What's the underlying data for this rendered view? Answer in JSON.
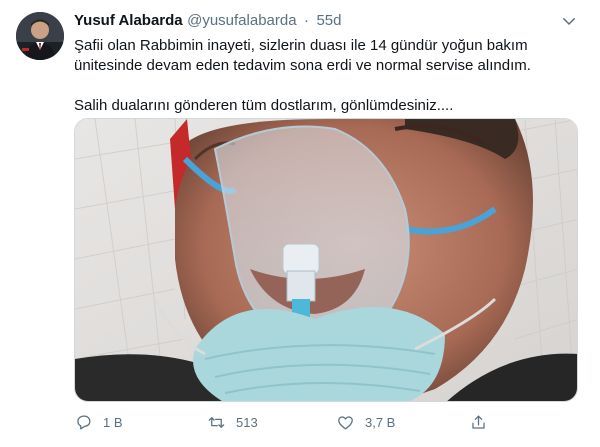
{
  "tweet": {
    "author_name": "Yusuf Alabarda",
    "author_handle": "@yusufalabarda",
    "separator": "·",
    "time": "55d",
    "text_line1": "Şafii olan Rabbimin inayeti, sizlerin duası ile 14 gündür yoğun bakım ünitesinde devam eden tedavim sona erdi ve normal servise alındım.",
    "text_line2": "Salih dualarını gönderen tüm dostlarım, gönlümdesiniz....",
    "replies": "1 B",
    "retweets": "513",
    "likes": "3,7 B"
  },
  "colors": {
    "text_primary": "#0f1419",
    "text_secondary": "#5b7083",
    "border": "#cfd9de"
  },
  "icons": [
    "reply-icon",
    "retweet-icon",
    "like-icon",
    "share-icon",
    "more-caret-icon"
  ]
}
